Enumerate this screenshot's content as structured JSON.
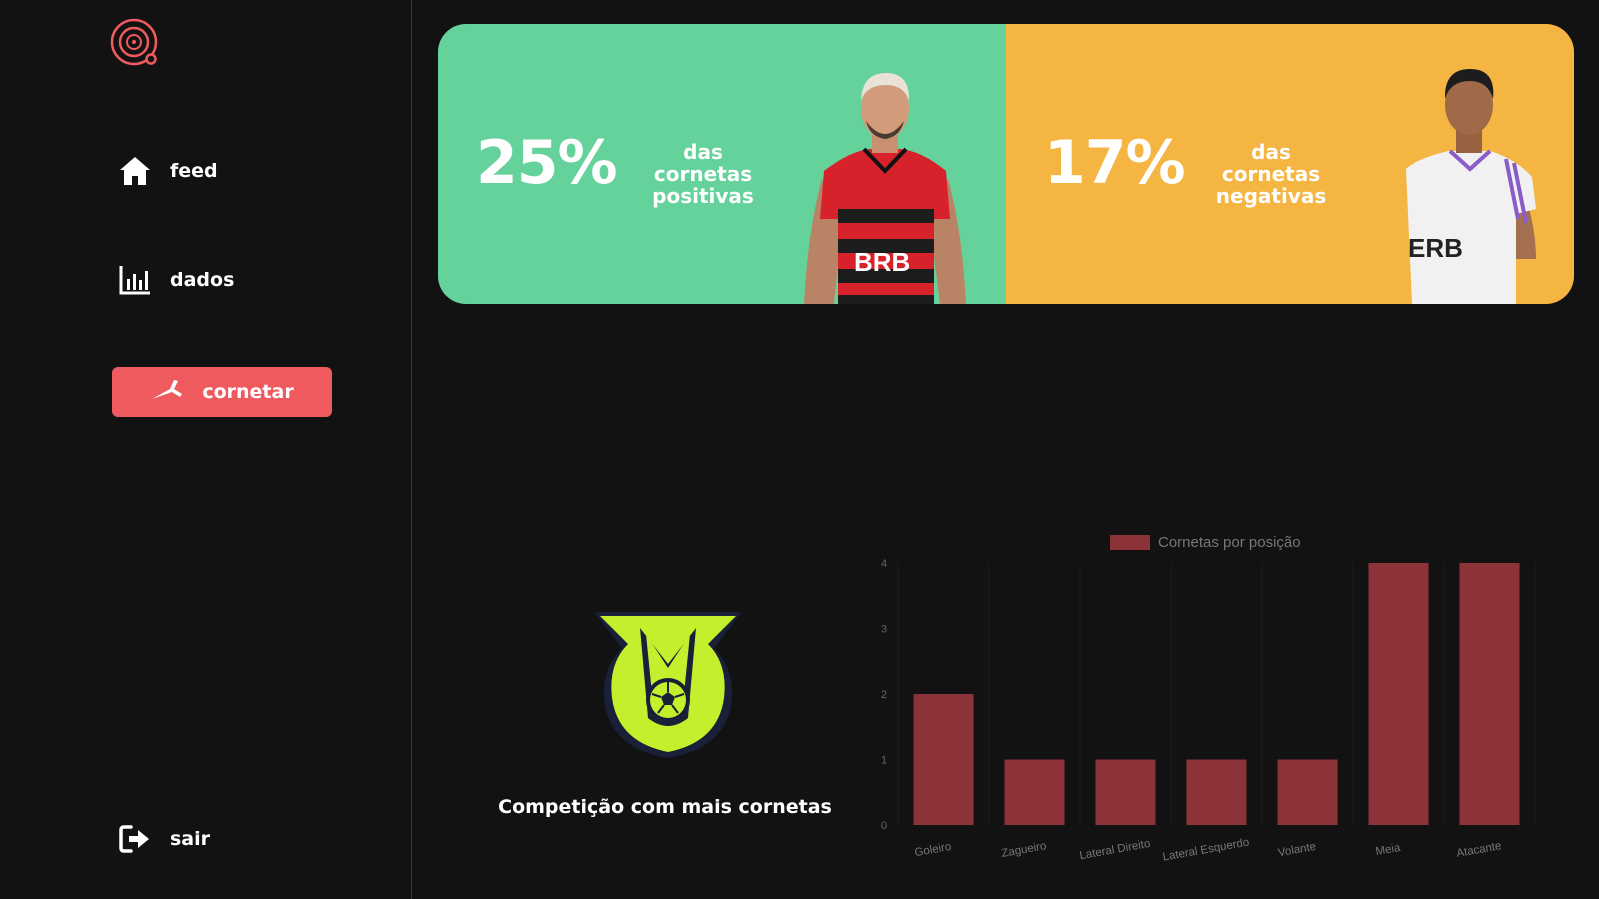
{
  "sidebar": {
    "logo_icon": "app-logo-icon",
    "items": [
      {
        "label": "feed",
        "icon": "home-icon"
      },
      {
        "label": "dados",
        "icon": "bar-chart-icon"
      }
    ],
    "primary_button": {
      "label": "cornetar",
      "icon": "horn-icon",
      "color": "#ef5a5f"
    },
    "logout": {
      "label": "sair",
      "icon": "logout-icon"
    }
  },
  "stats": {
    "positive": {
      "percent": "25%",
      "line1": "das cornetas",
      "line2": "positivas",
      "color": "#65d29c"
    },
    "negative": {
      "percent": "17%",
      "line1": "das cornetas",
      "line2": "negativas",
      "color": "#f4b542"
    }
  },
  "competition": {
    "caption": "Competição com mais cornetas",
    "logo_icon": "brasileirao-trophy-icon"
  },
  "chart_data": {
    "type": "bar",
    "title": "",
    "categories": [
      "Goleiro",
      "Zagueiro",
      "Lateral Direito",
      "Lateral Esquerdo",
      "Volante",
      "Meia",
      "Atacante"
    ],
    "series": [
      {
        "name": "Cornetas por posição",
        "values": [
          2,
          1,
          1,
          1,
          1,
          4,
          4
        ]
      }
    ],
    "ylim": [
      0,
      4
    ],
    "yticks": [
      0,
      1,
      2,
      3,
      4
    ],
    "legend": "top-center",
    "bar_color": "#8b3338",
    "grid": true
  }
}
